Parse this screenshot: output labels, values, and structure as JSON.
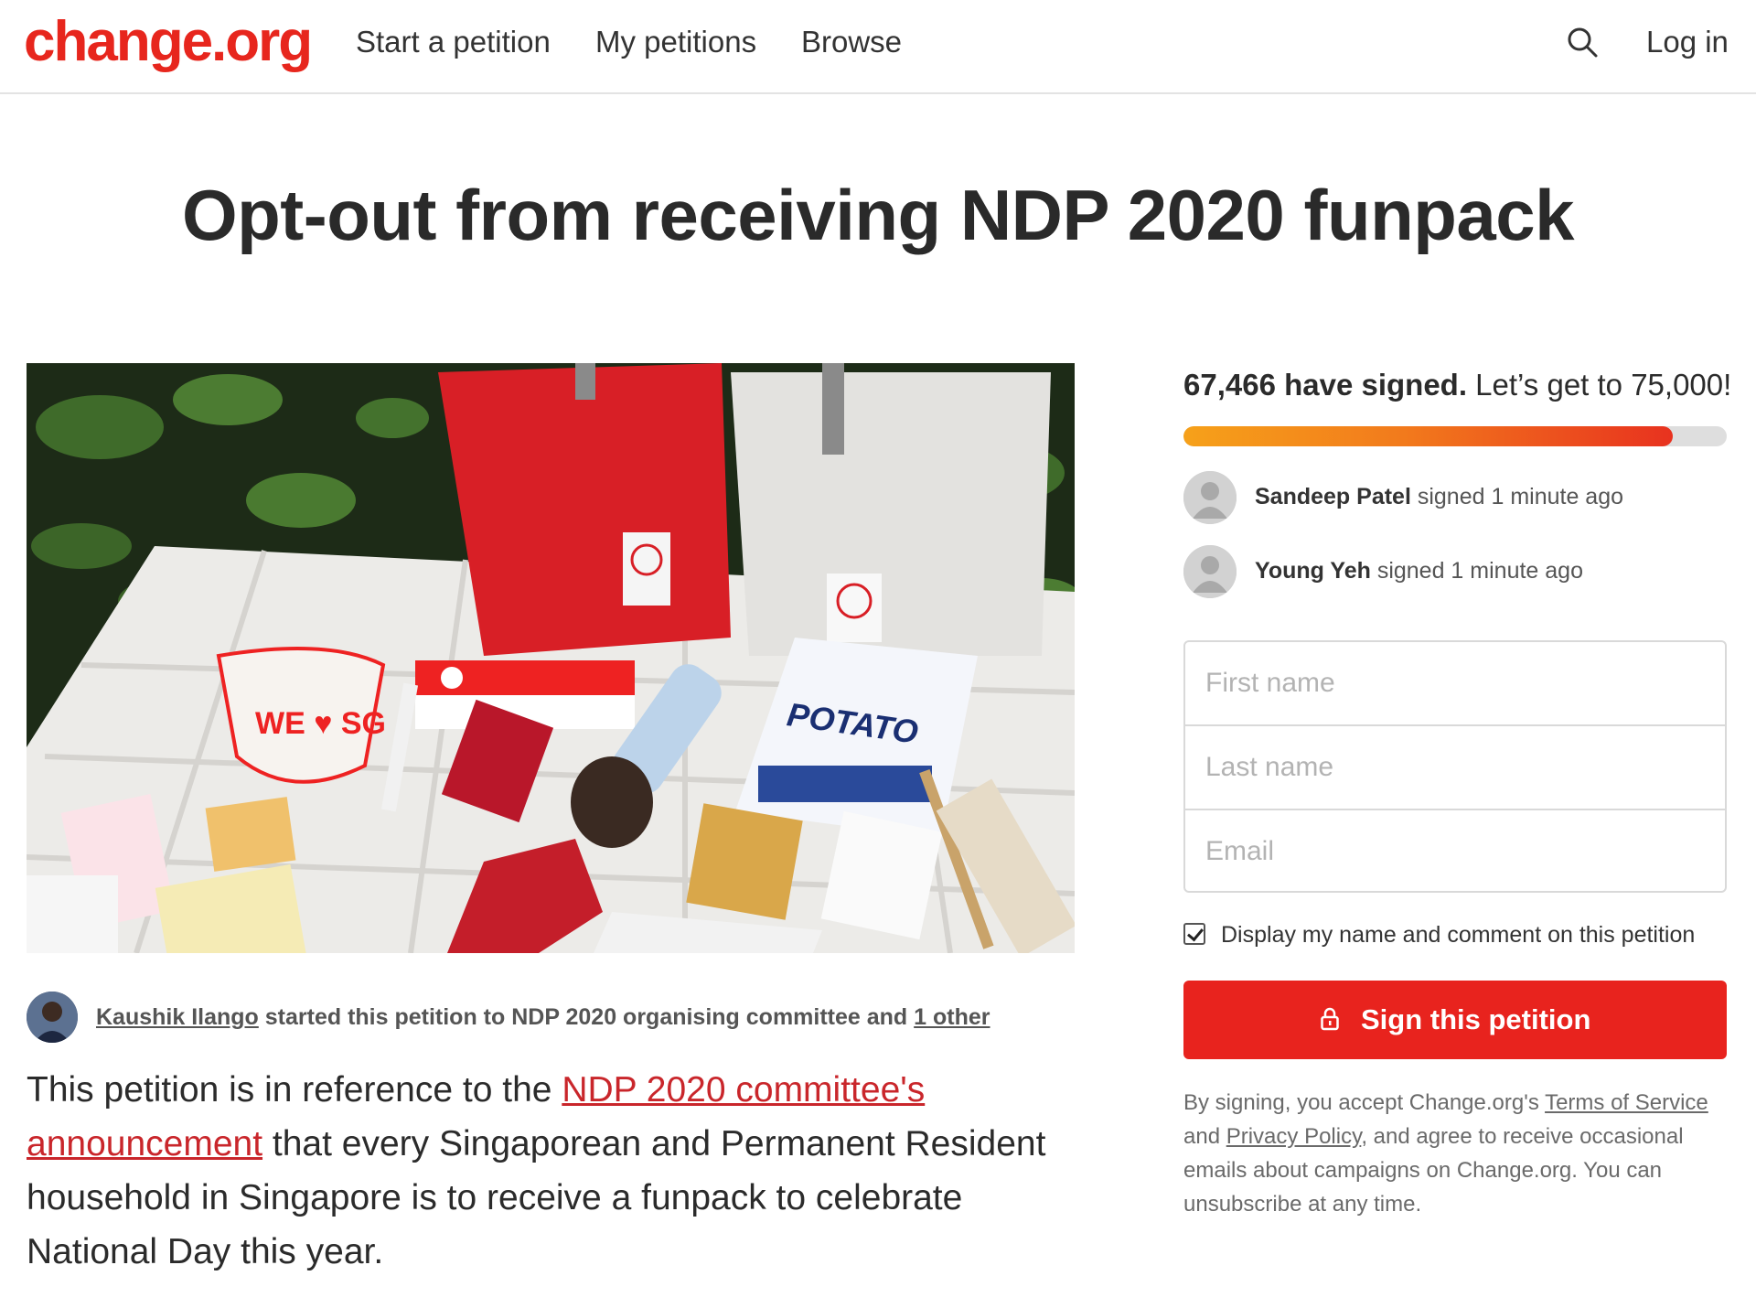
{
  "header": {
    "logo": "change.org",
    "nav": {
      "start": "Start a petition",
      "mine": "My petitions",
      "browse": "Browse"
    },
    "login": "Log in"
  },
  "petition": {
    "title": "Opt-out from receiving NDP 2020 funpack",
    "starter": {
      "name": "Kaushik Ilango",
      "middle": " started this petition to NDP 2020 organising committee and ",
      "other_link": "1 other"
    },
    "paragraph": {
      "p1": "This petition is in reference to the ",
      "link": "NDP 2020 committee's announcement",
      "p2": " that every Singaporean and Permanent Resident household in Singapore is to receive a funpack to celebrate National Day this year."
    }
  },
  "signatures": {
    "count_text": "67,466 have signed.",
    "goal_text": " Let’s get to 75,000!",
    "progress_fraction": 0.9
  },
  "recent_signers": [
    {
      "name": "Sandeep Patel",
      "action": " signed 1 minute ago"
    },
    {
      "name": "Young Yeh",
      "action": " signed 1 minute ago"
    }
  ],
  "form": {
    "first_name_placeholder": "First name",
    "last_name_placeholder": "Last name",
    "email_placeholder": "Email",
    "display_checkbox_label": "Display my name and comment on this petition",
    "display_checked": true,
    "sign_button": "Sign this petition"
  },
  "legal": {
    "t1": "By signing, you accept Change.org's ",
    "terms": "Terms of Service",
    "t2": " and ",
    "privacy": "Privacy Policy",
    "t3": ", and agree to receive occasional emails about campaigns on Change.org. You can unsubscribe at any time."
  },
  "colors": {
    "brand": "#e7261d",
    "link_red": "#c9262b",
    "progress_start": "#f6a11a",
    "progress_end": "#e8321f"
  }
}
